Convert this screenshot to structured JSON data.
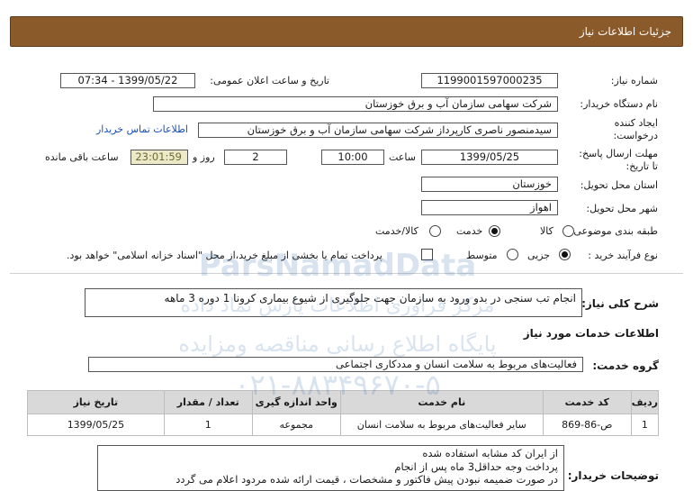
{
  "header": {
    "title": "جزئیات اطلاعات نیاز"
  },
  "form": {
    "need_number_label": "شماره نیاز:",
    "need_number": "1199001597000235",
    "announce_label": "تاریخ و ساعت اعلان عمومی:",
    "announce_value": "1399/05/22 - 07:34",
    "buyer_label": "نام دستگاه خریدار:",
    "buyer_value": "شرکت سهامی سازمان آب و برق خوزستان",
    "creator_label_1": "ایجاد کننده",
    "creator_label_2": "درخواست:",
    "creator_value": "سیدمنصور ناصری کارپرداز شرکت سهامی سازمان آب و برق خوزستان",
    "contact_link": "اطلاعات تماس خریدار",
    "deadline_label_1": "مهلت ارسال پاسخ:",
    "deadline_label_2": "تا تاریخ:",
    "deadline_date": "1399/05/25",
    "time_label": "ساعت",
    "deadline_time": "10:00",
    "days_value": "2",
    "days_label": "روز و",
    "timer_value": "23:01:59",
    "remaining_label": "ساعت باقی مانده",
    "province_label": "استان محل تحویل:",
    "province_value": "خوزستان",
    "city_label": "شهر محل تحویل:",
    "city_value": "اهواز",
    "category_label": "طبقه بندی موضوعی:",
    "category_options": [
      "کالا",
      "خدمت",
      "کالا/خدمت"
    ],
    "category_selected": "خدمت",
    "process_label": "نوع فرآیند خرید :",
    "process_options": [
      "جزیی",
      "متوسط"
    ],
    "process_selected": "جزیی",
    "payment_note": "پرداخت تمام یا بخشی از مبلغ خرید،از محل \"اسناد خزانه اسلامی\" خواهد بود."
  },
  "summary": {
    "label": "شرح کلی نیاز:",
    "text": "انجام تب سنجی در بدو ورود به سازمان جهت جلوگیری از شیوع بیماری کرونا 1 دوره 3 ماهه"
  },
  "services": {
    "section_title": "اطلاعات خدمات مورد نیاز",
    "group_label": "گروه خدمت:",
    "group_value": "فعالیت‌های مربوط به سلامت انسان و مددکاری اجتماعی",
    "columns": [
      "ردیف",
      "کد خدمت",
      "نام خدمت",
      "واحد اندازه گیری",
      "تعداد / مقدار",
      "تاریخ نیاز"
    ],
    "rows": [
      [
        "1",
        "ص-86-869",
        "سایر فعالیت‌های مربوط به سلامت انسان",
        "مجموعه",
        "1",
        "1399/05/25"
      ]
    ]
  },
  "notes": {
    "label": "توضیحات خریدار:",
    "lines": [
      "از ایران کد مشابه استفاده شده",
      "پرداخت وجه حداقل3 ماه پس از انجام",
      "در صورت ضمیمه نبودن پیش فاکتور و مشخصات ، قیمت ارائه شده مردود اعلام می گردد"
    ]
  },
  "watermark": {
    "lines": [
      "ParsNamadData",
      "مرکز فراوری اطلاعات پارس نماد داده",
      "پایگاه اطلاع رسانی مناقصه ومزایده",
      "۰۲۱-۸۸۳۴۹۶۷۰-۵"
    ]
  }
}
